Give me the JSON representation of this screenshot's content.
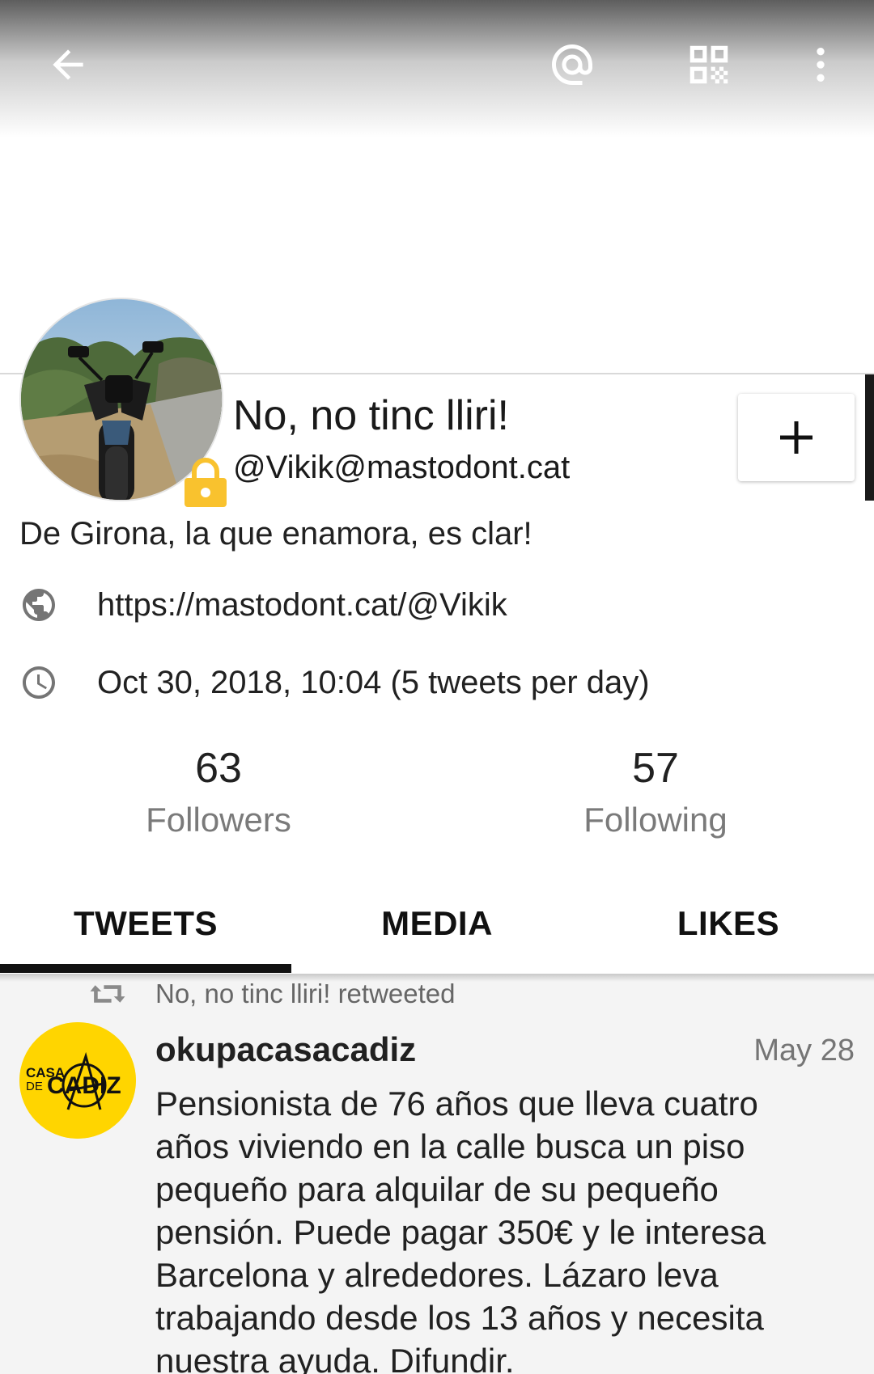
{
  "profile": {
    "display_name": "No, no tinc lliri!",
    "handle": "@Vikik@mastodont.cat",
    "bio": "De Girona, la que enamora, es clar!",
    "url": "https://mastodont.cat/@Vikik",
    "joined": "Oct 30, 2018, 10:04 (5 tweets per day)",
    "locked": true
  },
  "stats": {
    "followers_count": "63",
    "followers_label": "Followers",
    "following_count": "57",
    "following_label": "Following"
  },
  "tabs": [
    {
      "label": "TWEETS",
      "active": true
    },
    {
      "label": "MEDIA",
      "active": false
    },
    {
      "label": "LIKES",
      "active": false
    }
  ],
  "feed": {
    "retweet_label": "No, no tinc lliri! retweeted",
    "toot": {
      "author": "okupacasacadiz",
      "date": "May 28",
      "avatar_text_top": "CASA",
      "avatar_text_mid": "DE",
      "avatar_text_main": "CADIZ",
      "content": "Pensionista de 76 años que lleva cuatro años viviendo en la calle busca un piso pequeño para alquilar de su pequeño pensión. Puede pagar 350€ y le interesa Barcelona y alrededores. Lázaro leva trabajando desde los 13 años y necesita nuestra ayuda. Difundir."
    }
  },
  "icons": {
    "back": "arrow-back-icon",
    "mention": "at-sign-icon",
    "qr": "qr-code-icon",
    "more": "more-vert-icon",
    "lock": "lock-icon",
    "follow": "plus-icon",
    "web": "globe-icon",
    "time": "clock-icon",
    "retweet": "retweet-icon"
  },
  "colors": {
    "lock_badge": "#f9c22e",
    "avatar_badge_bg": "#ffd500",
    "secondary_text": "#7a7a7a"
  }
}
